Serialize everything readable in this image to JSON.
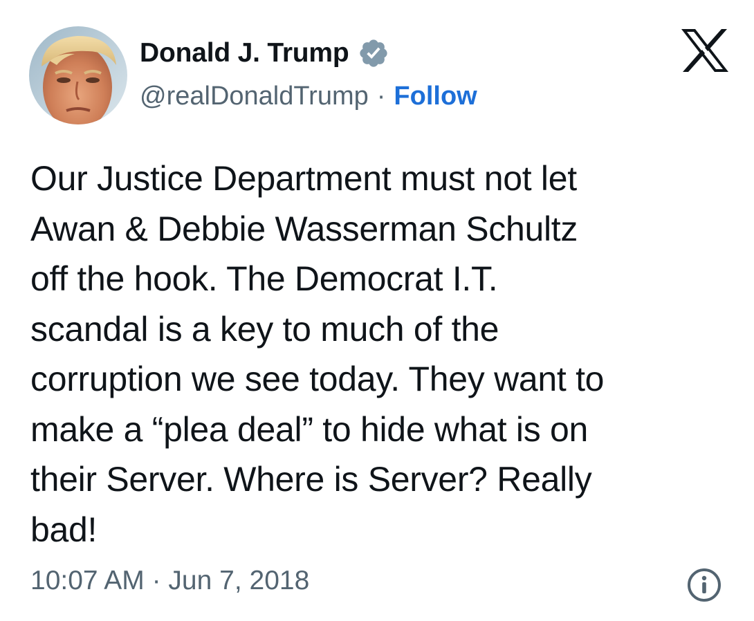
{
  "author": {
    "display_name": "Donald J. Trump",
    "handle": "@realDonaldTrump",
    "separator": "·",
    "follow_label": "Follow",
    "verified_icon": "verified-badge-icon",
    "avatar": "profile-avatar"
  },
  "platform": {
    "logo_icon": "x-logo-icon"
  },
  "tweet": {
    "lines": [
      "Our Justice Department must not let",
      "Awan & Debbie Wasserman Schultz",
      "off the hook. The Democrat I.T.",
      "scandal is a key to much of the",
      "corruption we see today. They want to",
      "make a “plea deal” to hide what is on",
      "their Server. Where is Server? Really",
      "bad!"
    ]
  },
  "footer": {
    "timestamp": "10:07 AM · Jun 7, 2018",
    "info_icon": "info-icon"
  },
  "colors": {
    "text": "#0f1419",
    "secondary": "#536471",
    "link": "#1d6fd8",
    "verified_badge": "#829aab"
  }
}
